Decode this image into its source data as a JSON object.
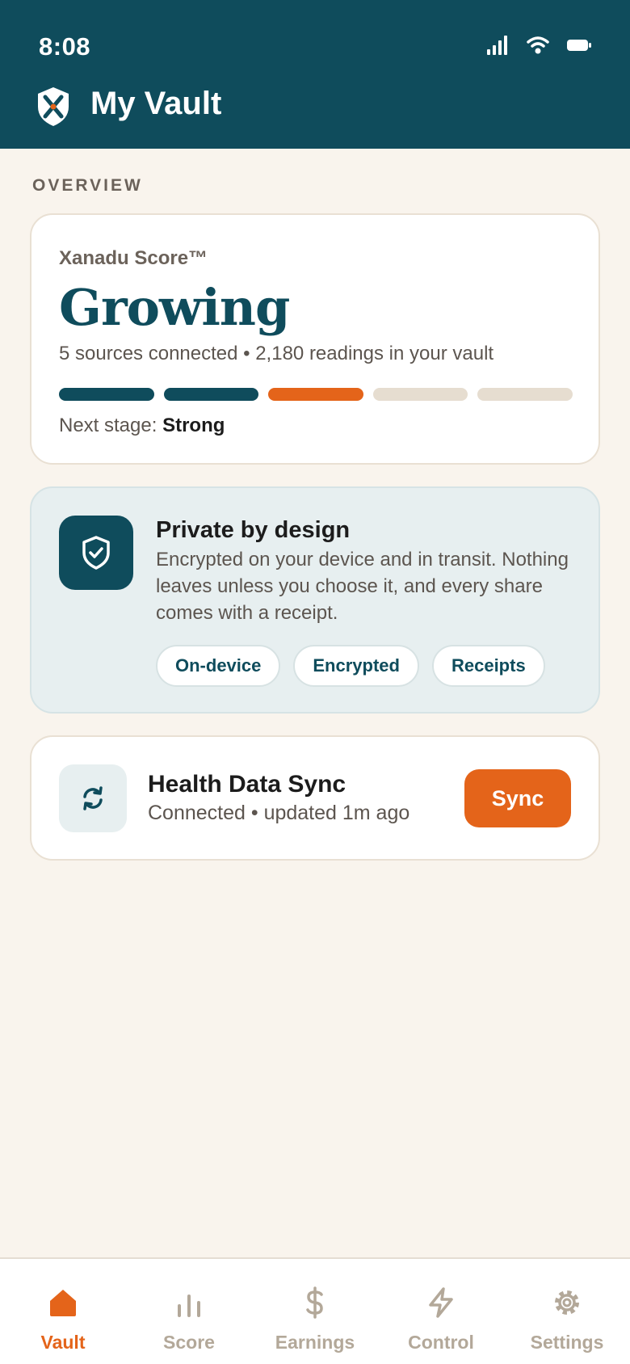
{
  "status_bar": {
    "time": "8:08"
  },
  "header": {
    "title": "My Vault"
  },
  "overview": {
    "section_label": "OVERVIEW"
  },
  "score_card": {
    "label": "Xanadu Score™",
    "value": "Growing",
    "subtitle": "5 sources connected • 2,180 readings in your vault",
    "progress": {
      "total_stages": 5,
      "completed": 2,
      "current": 3
    },
    "next_stage_prefix": "Next stage: ",
    "next_stage_value": "Strong"
  },
  "privacy_card": {
    "title": "Private by design",
    "body": "Encrypted on your device and in transit. Nothing leaves unless you choose it, and every share comes with a receipt.",
    "chips": [
      "On-device",
      "Encrypted",
      "Receipts"
    ]
  },
  "sync_card": {
    "title": "Health Data Sync",
    "subtitle": "Connected • updated 1m ago",
    "button_label": "Sync"
  },
  "tabs": [
    {
      "label": "Vault",
      "icon": "home-icon",
      "active": true
    },
    {
      "label": "Score",
      "icon": "bar-chart-icon",
      "active": false
    },
    {
      "label": "Earnings",
      "icon": "dollar-icon",
      "active": false
    },
    {
      "label": "Control",
      "icon": "lightning-icon",
      "active": false
    },
    {
      "label": "Settings",
      "icon": "gear-icon",
      "active": false
    }
  ],
  "colors": {
    "header_bg": "#0f4c5c",
    "accent": "#e4641a",
    "page_bg": "#f9f4ed",
    "inactive_tab": "#b3a899"
  }
}
